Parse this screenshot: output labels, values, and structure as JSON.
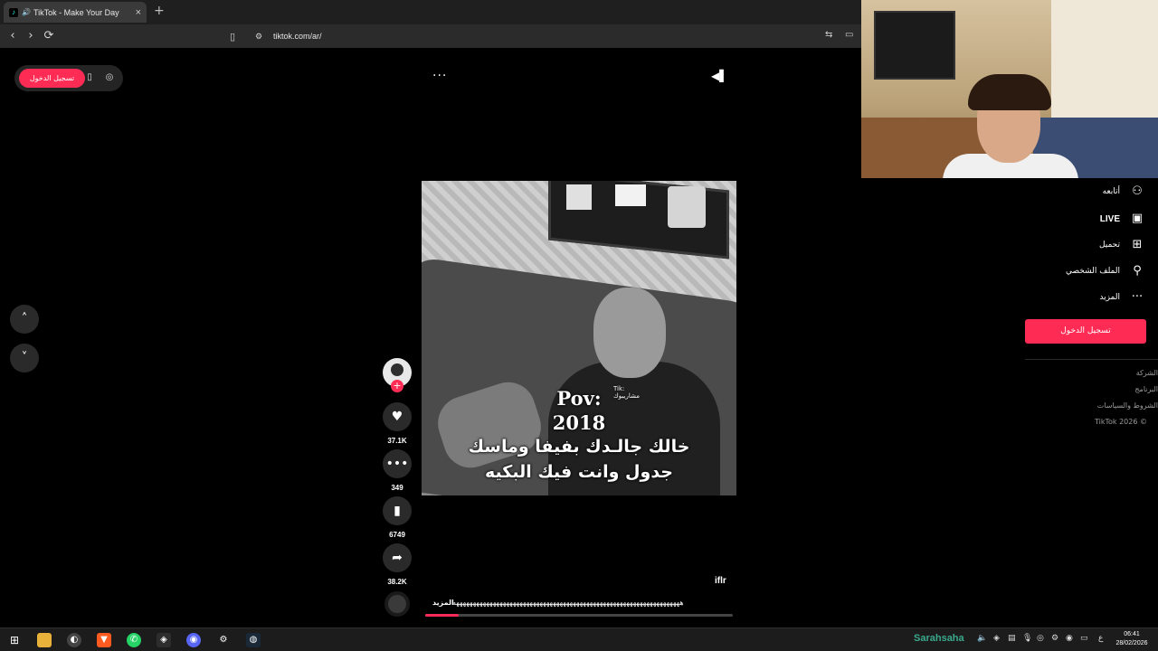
{
  "browser": {
    "tab_title": "TikTok - Make Your Day",
    "new_tab": "+",
    "tab_close": "×",
    "url": "tiktok.com/ar/"
  },
  "header": {
    "login_small": "تسجيل الدخول",
    "more_dots": "···"
  },
  "video": {
    "overlay_line1": "Pov:",
    "overlay_line2": "2018",
    "overlay_line3": "خالك جالـدك بفيفا وماسك",
    "overlay_line4": "جدول وانت فيك البكيه",
    "watermark": "Tik:\nمشاريبوك"
  },
  "actions": {
    "likes": "37.1K",
    "comments": "349",
    "saves": "6749",
    "shares": "38.2K"
  },
  "post": {
    "author": "iflr",
    "caption": "ههههههههههههههههههههههههههههههههههههههههههههههههههههههههههههههههههههه",
    "more": "المزيد",
    "progress_fraction": 0.11
  },
  "sidebar": {
    "items": [
      {
        "label": "أتابعه",
        "icon": "user-plus-icon"
      },
      {
        "label": "LIVE",
        "icon": "live-tv-icon"
      },
      {
        "label": "تحميل",
        "icon": "upload-plus-icon"
      },
      {
        "label": "الملف الشخصي",
        "icon": "profile-icon"
      },
      {
        "label": "المزيد",
        "icon": "more-icon"
      }
    ],
    "login_button": "تسجيل الدخول",
    "footer": [
      "الشركة",
      "البرنامج",
      "الشروط والسياسات",
      "TikTok 2026 ©"
    ]
  },
  "taskbar": {
    "widget": "Sarahsaha",
    "time": "06:41",
    "date": "28/02/2026",
    "lang": "ع"
  },
  "colors": {
    "accent": "#fe2c55",
    "background": "#000000",
    "panel": "#2a2a2a"
  }
}
